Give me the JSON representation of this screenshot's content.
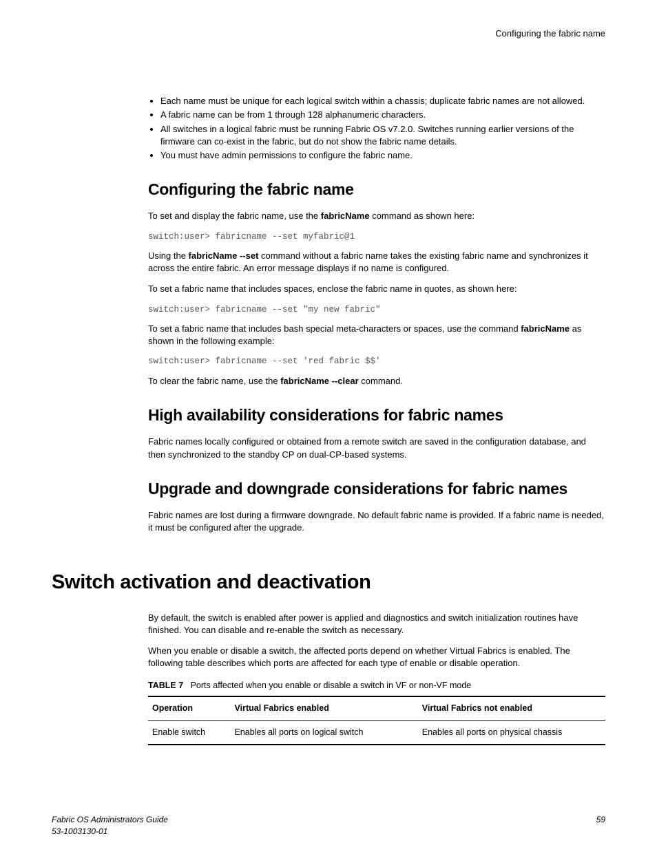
{
  "header": {
    "title": "Configuring the fabric name"
  },
  "bullets": {
    "b1": "Each name must be unique for each logical switch within a chassis; duplicate fabric names are not allowed.",
    "b2": "A fabric name can be from 1 through 128 alphanumeric characters.",
    "b3": "All switches in a logical fabric must be running Fabric OS v7.2.0. Switches running earlier versions of the firmware can co-exist in the fabric, but do not show the fabric name details.",
    "b4": "You must have admin permissions to configure the fabric name."
  },
  "s1": {
    "title": "Configuring the fabric name",
    "p1a": "To set and display the fabric name, use the ",
    "p1b": "fabricName",
    "p1c": " command as shown here:",
    "code1": "switch:user> fabricname --set myfabric@1",
    "p2a": "Using the ",
    "p2b": "fabricName --set",
    "p2c": " command without a fabric name takes the existing fabric name and synchronizes it across the entire fabric. An error message displays if no name is configured.",
    "p3": "To set a fabric name that includes spaces, enclose the fabric name in quotes, as shown here:",
    "code2": "switch:user> fabricname --set \"my new fabric\"",
    "p4a": "To set a fabric name that includes bash special meta-characters or spaces, use the command ",
    "p4b": "fabricName",
    "p4c": " as shown in the following example:",
    "code3": "switch:user> fabricname --set 'red fabric $$'",
    "p5a": "To clear the fabric name, use the ",
    "p5b": "fabricName --clear",
    "p5c": " command."
  },
  "s2": {
    "title": "High availability considerations for fabric names",
    "p1": "Fabric names locally configured or obtained from a remote switch are saved in the configuration database, and then synchronized to the standby CP on dual-CP-based systems."
  },
  "s3": {
    "title": "Upgrade and downgrade considerations for fabric names",
    "p1": "Fabric names are lost during a firmware downgrade. No default fabric name is provided. If a fabric name is needed, it must be configured after the upgrade."
  },
  "s4": {
    "title": "Switch activation and deactivation",
    "p1": "By default, the switch is enabled after power is applied and diagnostics and switch initialization routines have finished. You can disable and re-enable the switch as necessary.",
    "p2": "When you enable or disable a switch, the affected ports depend on whether Virtual Fabrics is enabled. The following table describes which ports are affected for each type of enable or disable operation.",
    "tcap_label": "TABLE 7",
    "tcap_text": "Ports affected when you enable or disable a switch in VF or non-VF mode"
  },
  "chart_data": {
    "type": "table",
    "columns": [
      "Operation",
      "Virtual Fabrics enabled",
      "Virtual Fabrics not enabled"
    ],
    "rows": [
      [
        "Enable switch",
        "Enables all ports on logical switch",
        "Enables all ports on physical chassis"
      ]
    ]
  },
  "footer": {
    "line1": "Fabric OS Administrators Guide",
    "line2": "53-1003130-01",
    "page": "59"
  }
}
